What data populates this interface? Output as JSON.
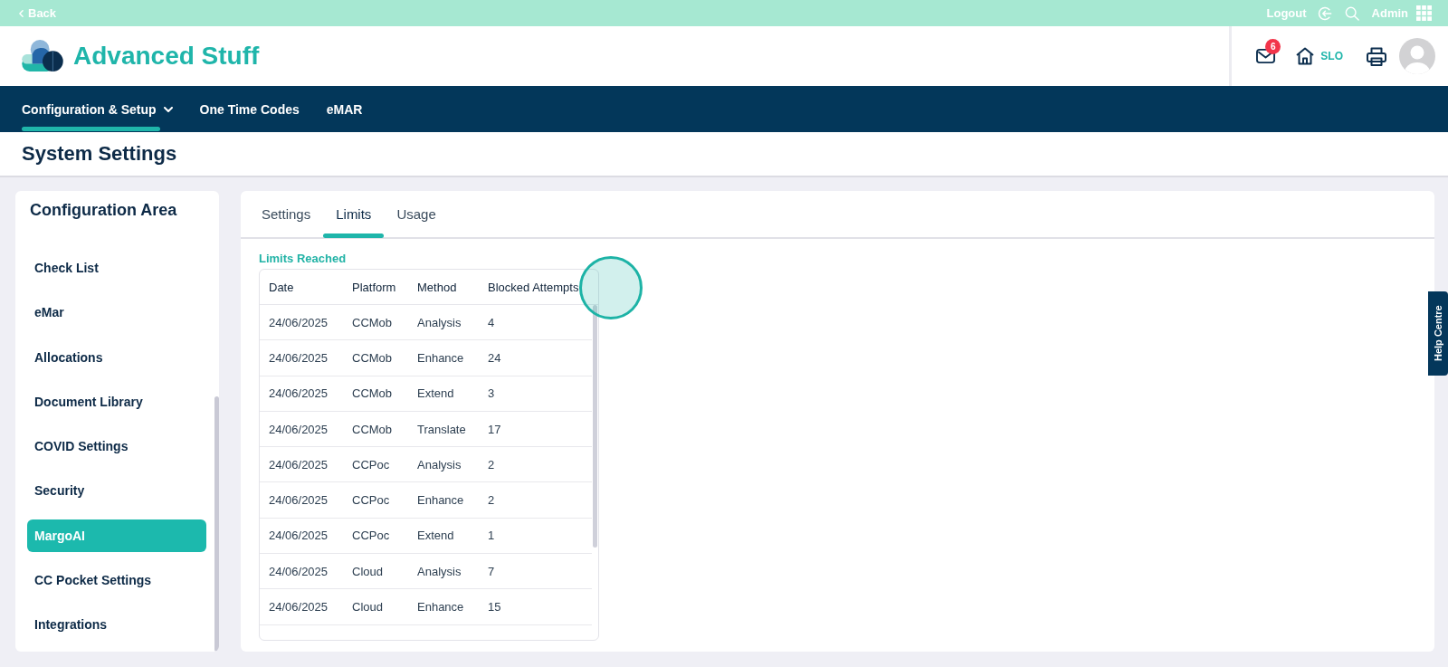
{
  "top_bar": {
    "back_label": "Back",
    "logout_label": "Logout",
    "user_label": "Admin"
  },
  "header": {
    "app_name": "Advanced Stuff",
    "unread_count": "6",
    "site_label": "SLO"
  },
  "nav": {
    "items": [
      {
        "label": "Configuration & Setup",
        "selected": true,
        "has_menu": true
      },
      {
        "label": "One Time Codes",
        "selected": false,
        "has_menu": false
      },
      {
        "label": "eMAR",
        "selected": false,
        "has_menu": false
      }
    ]
  },
  "page": {
    "title": "System Settings"
  },
  "sidebar": {
    "title": "Configuration Area",
    "items": [
      {
        "label": "Check List",
        "selected": false
      },
      {
        "label": "eMar",
        "selected": false
      },
      {
        "label": "Allocations",
        "selected": false
      },
      {
        "label": "Document Library",
        "selected": false
      },
      {
        "label": "COVID Settings",
        "selected": false
      },
      {
        "label": "Security",
        "selected": false
      },
      {
        "label": "MargoAI",
        "selected": true
      },
      {
        "label": "CC Pocket Settings",
        "selected": false
      },
      {
        "label": "Integrations",
        "selected": false
      }
    ]
  },
  "main": {
    "tabs": [
      {
        "label": "Settings",
        "selected": false
      },
      {
        "label": "Limits",
        "selected": true
      },
      {
        "label": "Usage",
        "selected": false
      }
    ],
    "section_title": "Limits Reached",
    "table": {
      "columns": [
        "Date",
        "Platform",
        "Method",
        "Blocked Attempts"
      ],
      "rows": [
        [
          "24/06/2025",
          "CCMob",
          "Analysis",
          "4"
        ],
        [
          "24/06/2025",
          "CCMob",
          "Enhance",
          "24"
        ],
        [
          "24/06/2025",
          "CCMob",
          "Extend",
          "3"
        ],
        [
          "24/06/2025",
          "CCMob",
          "Translate",
          "17"
        ],
        [
          "24/06/2025",
          "CCPoc",
          "Analysis",
          "2"
        ],
        [
          "24/06/2025",
          "CCPoc",
          "Enhance",
          "2"
        ],
        [
          "24/06/2025",
          "CCPoc",
          "Extend",
          "1"
        ],
        [
          "24/06/2025",
          "Cloud",
          "Analysis",
          "7"
        ],
        [
          "24/06/2025",
          "Cloud",
          "Enhance",
          "15"
        ]
      ]
    }
  },
  "click_marker": {
    "visible": true
  },
  "help_tab": {
    "label": "Help Centre"
  }
}
